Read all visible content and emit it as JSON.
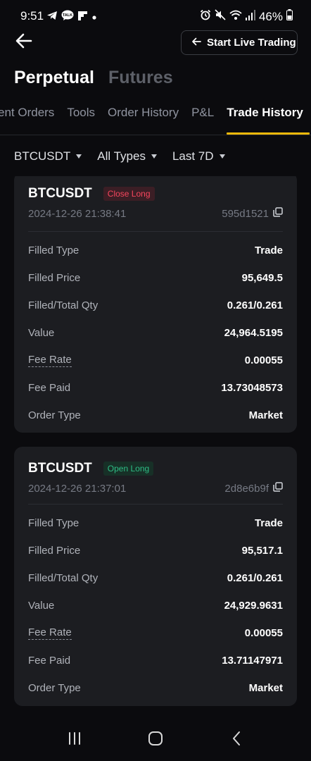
{
  "status_bar": {
    "time": "9:51",
    "battery": "46%",
    "icons": [
      "telegram-icon",
      "talk-icon",
      "flipboard-icon",
      "dot-icon",
      "alarm-icon",
      "mute-icon",
      "wifi-icon",
      "signal-icon",
      "battery-icon"
    ]
  },
  "header": {
    "back_icon": "arrow-left-icon",
    "live_button_icon": "arrow-left-icon",
    "live_button_label": "Start Live Trading",
    "title_active": "Perpetual",
    "title_inactive": "Futures"
  },
  "tabs": [
    {
      "label": "ent Orders",
      "active": false
    },
    {
      "label": "Tools",
      "active": false
    },
    {
      "label": "Order History",
      "active": false
    },
    {
      "label": "P&L",
      "active": false
    },
    {
      "label": "Trade History",
      "active": true
    }
  ],
  "filters": {
    "symbol": "BTCUSDT",
    "type": "All Types",
    "period": "Last 7D"
  },
  "trades": [
    {
      "symbol": "BTCUSDT",
      "badge": "Close Long",
      "badge_kind": "close",
      "timestamp": "2024-12-26 21:38:41",
      "order_id": "595d1521",
      "rows": [
        {
          "label": "Filled Type",
          "value": "Trade"
        },
        {
          "label": "Filled Price",
          "value": "95,649.5"
        },
        {
          "label": "Filled/Total Qty",
          "value": "0.261/0.261"
        },
        {
          "label": "Value",
          "value": "24,964.5195"
        },
        {
          "label": "Fee Rate",
          "value": "0.00055"
        },
        {
          "label": "Fee Paid",
          "value": "13.73048573"
        },
        {
          "label": "Order Type",
          "value": "Market"
        }
      ]
    },
    {
      "symbol": "BTCUSDT",
      "badge": "Open Long",
      "badge_kind": "open",
      "timestamp": "2024-12-26 21:37:01",
      "order_id": "2d8e6b9f",
      "rows": [
        {
          "label": "Filled Type",
          "value": "Trade"
        },
        {
          "label": "Filled Price",
          "value": "95,517.1"
        },
        {
          "label": "Filled/Total Qty",
          "value": "0.261/0.261"
        },
        {
          "label": "Value",
          "value": "24,929.9631"
        },
        {
          "label": "Fee Rate",
          "value": "0.00055"
        },
        {
          "label": "Fee Paid",
          "value": "13.71147971"
        },
        {
          "label": "Order Type",
          "value": "Market"
        }
      ]
    }
  ],
  "nav_bar": [
    "recents-icon",
    "home-icon",
    "back-icon"
  ],
  "colors": {
    "accent": "#f0b90b",
    "close_red": "#f6465d",
    "open_green": "#2ebd85",
    "card_bg": "#1c1d21"
  }
}
